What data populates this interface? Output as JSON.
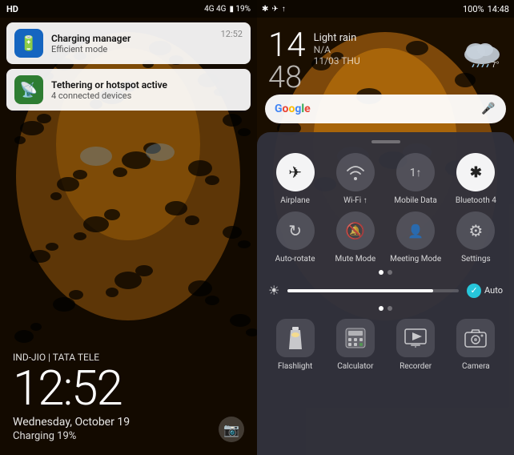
{
  "left": {
    "statusbar": {
      "left": "HD",
      "signals": "4G | 4G",
      "battery": "19%"
    },
    "notifications": [
      {
        "id": "charging",
        "icon": "🔋",
        "icon_color": "blue",
        "title": "Charging manager",
        "subtitle": "Efficient mode",
        "time": "12:52"
      },
      {
        "id": "hotspot",
        "icon": "📡",
        "icon_color": "green",
        "title": "Tethering or hotspot active",
        "subtitle": "4 connected devices",
        "time": ""
      }
    ],
    "carrier": "IND-JIO | TATA TELE",
    "clock": "12:52",
    "date": "Wednesday, October 19",
    "charging": "Charging 19%"
  },
  "right": {
    "statusbar": {
      "icons": [
        "🔵",
        "✈",
        "↑"
      ],
      "battery": "100%",
      "time": "14:48"
    },
    "weather": {
      "temp_main": "14",
      "temp_secondary": "48",
      "condition": "Light rain",
      "extra": "N/A",
      "date": "11/03 THU",
      "temp_unit": "7°"
    },
    "search": {
      "google_label": "Google",
      "mic_label": "🎤"
    },
    "quick_settings": {
      "handle": "",
      "toggles_row1": [
        {
          "id": "airplane",
          "icon": "✈",
          "label": "Airplane",
          "active": true
        },
        {
          "id": "wifi",
          "icon": "📶",
          "label": "Wi-Fi ↑",
          "active": false
        },
        {
          "id": "mobile_data",
          "icon": "1↑",
          "label": "Mobile Data",
          "active": false
        },
        {
          "id": "bluetooth",
          "icon": "🔵",
          "label": "Bluetooth 4",
          "active": true
        }
      ],
      "toggles_row2": [
        {
          "id": "auto_rotate",
          "icon": "🔄",
          "label": "Auto-rotate",
          "active": false
        },
        {
          "id": "mute",
          "icon": "🔕",
          "label": "Mute Mode",
          "active": false
        },
        {
          "id": "meeting",
          "icon": "👤",
          "label": "Meeting Mode",
          "active": false
        },
        {
          "id": "settings",
          "icon": "⚙",
          "label": "Settings",
          "active": false
        }
      ],
      "brightness": {
        "icon": "☀",
        "fill_percent": 85,
        "auto_label": "Auto"
      },
      "apps": [
        {
          "id": "flashlight",
          "icon": "🔦",
          "label": "Flashlight"
        },
        {
          "id": "calculator",
          "icon": "🧮",
          "label": "Calculator"
        },
        {
          "id": "recorder",
          "icon": "📺",
          "label": "Recorder"
        },
        {
          "id": "camera",
          "icon": "📷",
          "label": "Camera"
        }
      ]
    }
  }
}
